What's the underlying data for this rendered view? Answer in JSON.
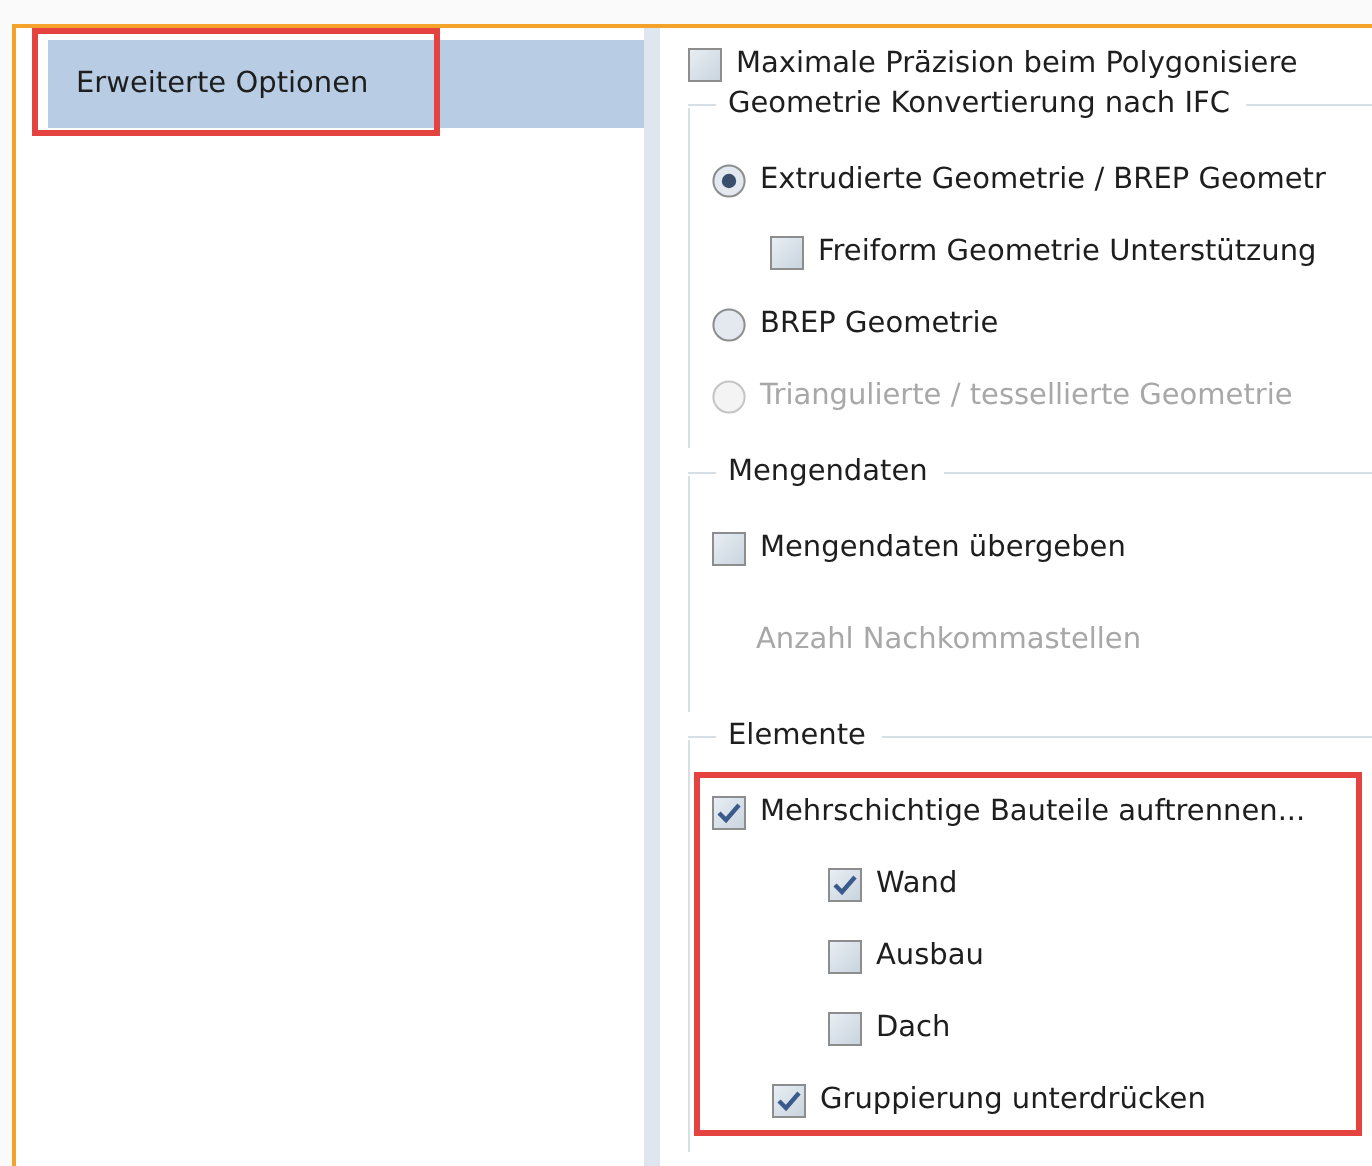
{
  "sidebar": {
    "items": [
      {
        "label": "Erweiterte Optionen",
        "selected": true,
        "highlight": true
      }
    ]
  },
  "options": [
    {
      "kind": "checkbox",
      "label": "Maximale Präzision beim Polygonisiere",
      "checked": false,
      "disabled": false
    }
  ],
  "groups": [
    {
      "title": "Geometrie Konvertierung nach IFC",
      "highlight": false,
      "items": [
        {
          "kind": "radio",
          "label": "Extrudierte Geometrie / BREP Geometr",
          "selected": true,
          "disabled": false,
          "children": [
            {
              "kind": "checkbox",
              "label": "Freiform Geometrie Unterstützung",
              "checked": false,
              "disabled": false
            }
          ]
        },
        {
          "kind": "radio",
          "label": "BREP Geometrie",
          "selected": false,
          "disabled": false
        },
        {
          "kind": "radio",
          "label": "Triangulierte / tessellierte Geometrie",
          "selected": false,
          "disabled": true
        }
      ]
    },
    {
      "title": "Mengendaten",
      "highlight": false,
      "items": [
        {
          "kind": "checkbox",
          "label": "Mengendaten übergeben",
          "checked": false,
          "disabled": false
        },
        {
          "kind": "label",
          "label": "Anzahl Nachkommastellen",
          "disabled": true
        }
      ]
    },
    {
      "title": "Elemente",
      "highlight": true,
      "items": [
        {
          "kind": "checkbox",
          "label": "Mehrschichtige Bauteile auftrennen...",
          "checked": true,
          "disabled": false,
          "children": [
            {
              "kind": "checkbox",
              "label": "Wand",
              "checked": true,
              "disabled": false
            },
            {
              "kind": "checkbox",
              "label": "Ausbau",
              "checked": false,
              "disabled": false
            },
            {
              "kind": "checkbox",
              "label": "Dach",
              "checked": false,
              "disabled": false
            }
          ]
        },
        {
          "kind": "sub_checkbox",
          "label": "Gruppierung unterdrücken",
          "checked": true,
          "disabled": false
        }
      ]
    }
  ]
}
